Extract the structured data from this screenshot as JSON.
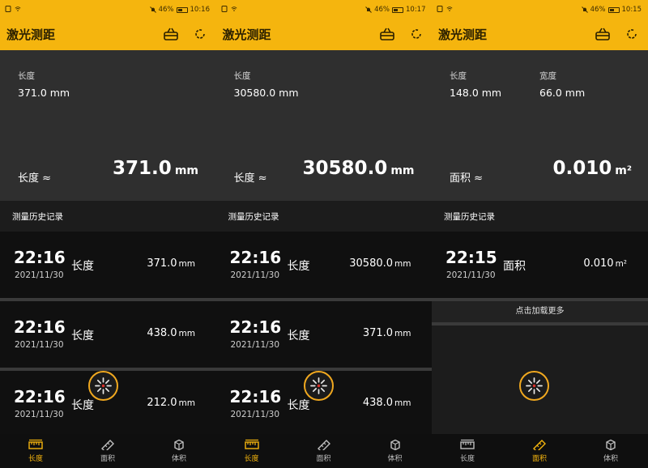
{
  "screens": [
    {
      "status": {
        "battery": "46%",
        "time": "10:16"
      },
      "app_title": "激光测距",
      "measure": {
        "fields": [
          {
            "label": "长度",
            "value": "371.0 mm"
          }
        ],
        "result_label": "长度 ≈",
        "result_value": "371.0",
        "result_unit": "mm"
      },
      "history_title": "测量历史记录",
      "records": [
        {
          "time": "22:16",
          "date": "2021/11/30",
          "type": "长度",
          "value": "371.0",
          "unit": "mm"
        },
        {
          "time": "22:16",
          "date": "2021/11/30",
          "type": "长度",
          "value": "438.0",
          "unit": "mm"
        },
        {
          "time": "22:16",
          "date": "2021/11/30",
          "type": "长度",
          "value": "212.0",
          "unit": "mm"
        }
      ],
      "nav": {
        "items": [
          "长度",
          "面积",
          "体积"
        ],
        "active": 0
      }
    },
    {
      "status": {
        "battery": "46%",
        "time": "10:17"
      },
      "app_title": "激光测距",
      "measure": {
        "fields": [
          {
            "label": "长度",
            "value": "30580.0 mm"
          }
        ],
        "result_label": "长度 ≈",
        "result_value": "30580.0",
        "result_unit": "mm"
      },
      "history_title": "测量历史记录",
      "records": [
        {
          "time": "22:16",
          "date": "2021/11/30",
          "type": "长度",
          "value": "30580.0",
          "unit": "mm"
        },
        {
          "time": "22:16",
          "date": "2021/11/30",
          "type": "长度",
          "value": "371.0",
          "unit": "mm"
        },
        {
          "time": "22:16",
          "date": "2021/11/30",
          "type": "长度",
          "value": "438.0",
          "unit": "mm"
        }
      ],
      "nav": {
        "items": [
          "长度",
          "面积",
          "体积"
        ],
        "active": 0
      }
    },
    {
      "status": {
        "battery": "46%",
        "time": "10:15"
      },
      "app_title": "激光测距",
      "measure": {
        "fields": [
          {
            "label": "长度",
            "value": "148.0 mm"
          },
          {
            "label": "宽度",
            "value": "66.0 mm"
          }
        ],
        "result_label": "面积 ≈",
        "result_value": "0.010",
        "result_unit": "m²"
      },
      "history_title": "测量历史记录",
      "records": [
        {
          "time": "22:15",
          "date": "2021/11/30",
          "type": "面积",
          "value": "0.010",
          "unit": "m²"
        }
      ],
      "load_more": "点击加载更多",
      "nav": {
        "items": [
          "长度",
          "面积",
          "体积"
        ],
        "active": 1
      }
    }
  ],
  "colors": {
    "accent": "#f5b50e",
    "fab_ring": "#f0a81f",
    "fab_center": "#d9302a"
  },
  "icons": [
    "wifi-icon",
    "mute-icon",
    "battery-icon",
    "basket-icon",
    "refresh-icon",
    "laser-fab-icon",
    "ruler-icon",
    "area-icon",
    "volume-icon"
  ]
}
